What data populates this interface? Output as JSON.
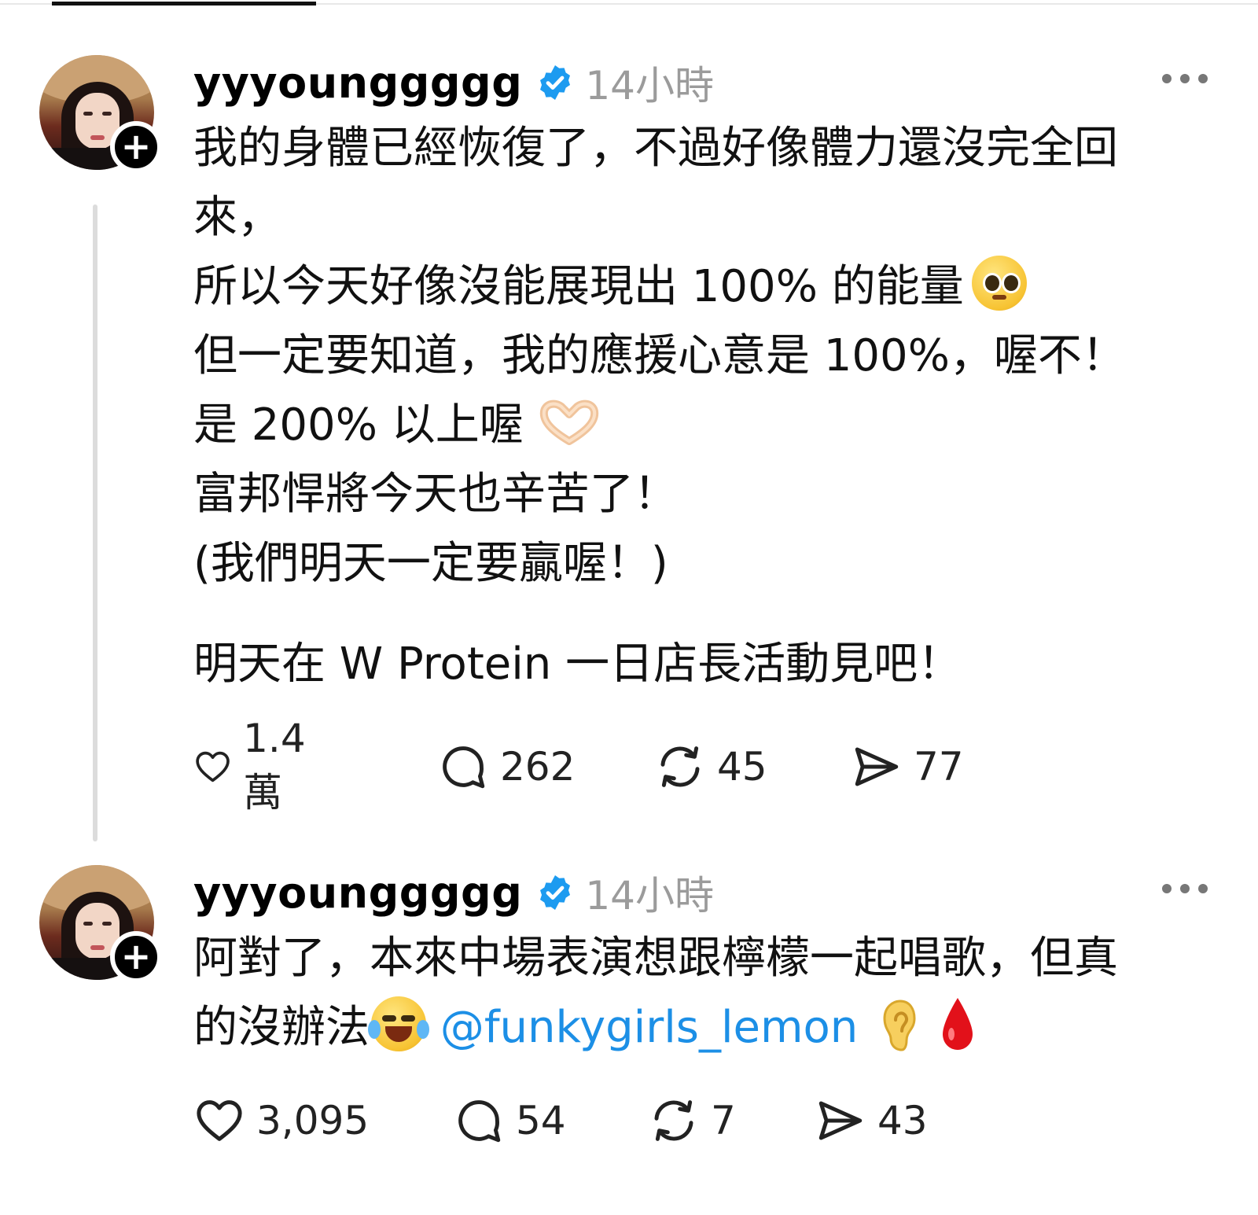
{
  "posts": [
    {
      "username": "yyyounggggg",
      "time": "14小時",
      "body_lines": [
        "我的身體已經恢復了，不過好像體力還沒完全回",
        "來，",
        "所以今天好像沒能展現出 100% 的能量",
        "但一定要知道，我的應援心意是 100%，喔不！",
        "是 200% 以上喔",
        "富邦悍將今天也辛苦了！",
        "(我們明天一定要贏喔！)",
        "明天在 W Protein 一日店長活動見吧！"
      ],
      "emojis": [
        "pleading-face-emoji",
        "heart-hands-emoji"
      ],
      "actions": {
        "likes": "1.4萬",
        "comments": "262",
        "reposts": "45",
        "shares": "77"
      }
    },
    {
      "username": "yyyounggggg",
      "time": "14小時",
      "body_lines": [
        "阿對了，本來中場表演想跟檸檬一起唱歌，但真",
        "的沒辦法"
      ],
      "mention": "@funkygirls_lemon",
      "emojis": [
        "tears-of-joy-emoji",
        "ear-emoji",
        "drop-of-blood-emoji"
      ],
      "actions": {
        "likes": "3,095",
        "comments": "54",
        "reposts": "7",
        "shares": "43"
      }
    }
  ],
  "colors": {
    "verified": "#1d9bf0",
    "mention": "#1c8fe6",
    "muted": "#9b9b9b"
  },
  "icons": [
    "heart-icon",
    "comment-icon",
    "repost-icon",
    "share-icon",
    "more-icon",
    "verified-badge-icon",
    "follow-plus-icon"
  ]
}
